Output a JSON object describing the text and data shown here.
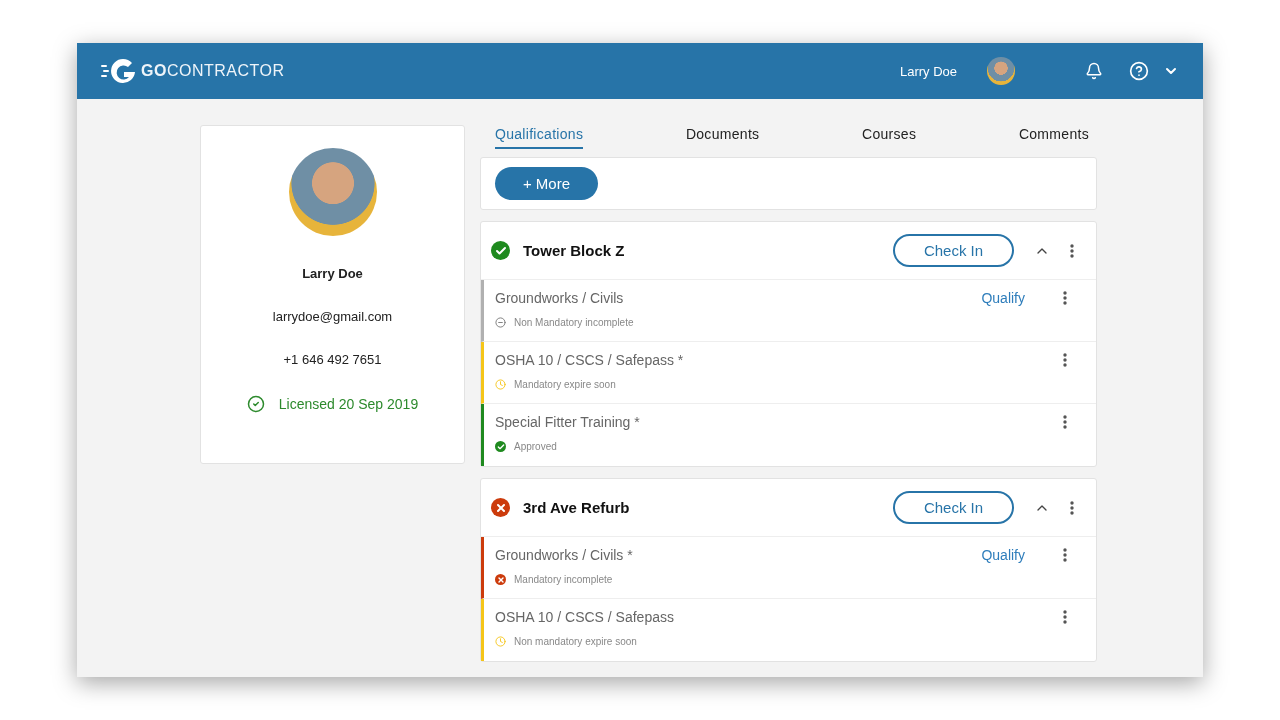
{
  "header": {
    "logo": "**GO**CONTRACTOR",
    "user_name": "Larry Doe",
    "menu_open": false
  },
  "profile": {
    "name": "Larry Doe",
    "email": "larrydoe@gmail.com",
    "phone": "+1 646 492 7651",
    "license": "Licensed 20 Sep 2019"
  },
  "tabs": [
    {
      "label": "Qualifications",
      "selected": true
    },
    {
      "label": "Documents",
      "selected": false
    },
    {
      "label": "Courses",
      "selected": false
    },
    {
      "label": "Comments",
      "selected": false
    }
  ],
  "more_button": "+ More",
  "sites": [
    {
      "name": "Tower Block Z",
      "kind": "ok",
      "check_in": "Check In",
      "expanded": true,
      "items": [
        {
          "title": "Groundworks / Civils",
          "kind": "optional",
          "note": "Non Mandatory incomplete",
          "action": "Qualify"
        },
        {
          "title": "OSHA 10 / CSCS / Safepass *",
          "kind": "expiring",
          "note": "Mandatory expire soon"
        },
        {
          "title": "Special Fitter Training *",
          "kind": "approved",
          "note": "Approved"
        }
      ]
    },
    {
      "name": "3rd Ave Refurb",
      "kind": "error",
      "check_in": "Check In",
      "expanded": true,
      "items": [
        {
          "title": "Groundworks / Civils *",
          "kind": "missing",
          "note": "Mandatory incomplete",
          "action": "Qualify"
        },
        {
          "title": "OSHA 10 / CSCS / Safepass",
          "kind": "expiring",
          "note": "Non mandatory expire soon"
        }
      ]
    }
  ]
}
